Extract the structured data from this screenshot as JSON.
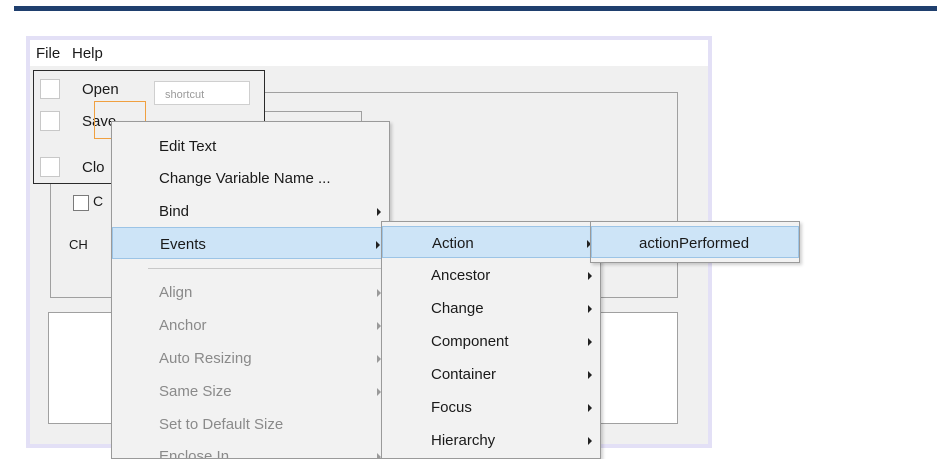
{
  "menubar": {
    "file": "File",
    "help": "Help"
  },
  "file_menu": {
    "open": "Open",
    "save": "Save",
    "close": "Clo",
    "shortcut_placeholder": "shortcut"
  },
  "panel": {
    "checkbox_label": "C",
    "ch_label": "CH"
  },
  "context_menu": {
    "items": [
      {
        "label": "Edit Text",
        "submenu": false,
        "enabled": true
      },
      {
        "label": "Change Variable Name ...",
        "submenu": false,
        "enabled": true
      },
      {
        "label": "Bind",
        "submenu": true,
        "enabled": true
      },
      {
        "label": "Events",
        "submenu": true,
        "enabled": true,
        "highlighted": true
      },
      {
        "label": "Align",
        "submenu": true,
        "enabled": false
      },
      {
        "label": "Anchor",
        "submenu": true,
        "enabled": false
      },
      {
        "label": "Auto Resizing",
        "submenu": true,
        "enabled": false
      },
      {
        "label": "Same Size",
        "submenu": true,
        "enabled": false
      },
      {
        "label": "Set to Default Size",
        "submenu": false,
        "enabled": false
      },
      {
        "label": "Enclose In",
        "submenu": true,
        "enabled": false
      }
    ]
  },
  "events_menu": {
    "items": [
      {
        "label": "Action",
        "highlighted": true
      },
      {
        "label": "Ancestor"
      },
      {
        "label": "Change"
      },
      {
        "label": "Component"
      },
      {
        "label": "Container"
      },
      {
        "label": "Focus"
      },
      {
        "label": "Hierarchy"
      }
    ]
  },
  "action_menu": {
    "items": [
      {
        "label": "actionPerformed",
        "highlighted": true
      }
    ]
  },
  "colors": {
    "accent_bar": "#1f3f6e",
    "highlight": "#cde4f7",
    "selection": "#f0a040"
  }
}
